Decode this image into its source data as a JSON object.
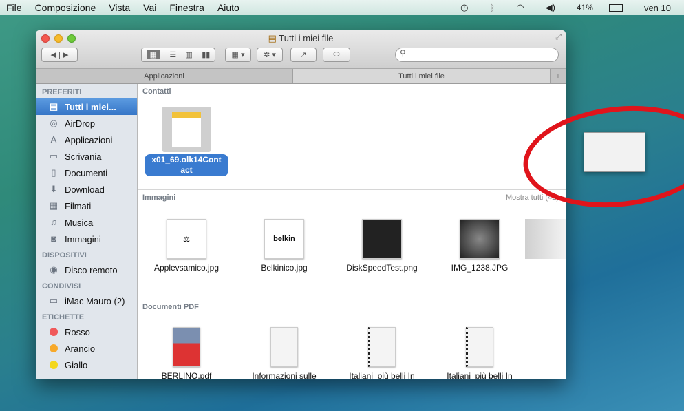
{
  "menubar": {
    "apple": "",
    "items": [
      "File",
      "Composizione",
      "Vista",
      "Vai",
      "Finestra",
      "Aiuto"
    ],
    "battery": "41%",
    "clock": "ven 10"
  },
  "window": {
    "title": "Tutti i miei file",
    "search_placeholder": "",
    "tabs": [
      "Applicazioni",
      "Tutti i miei file"
    ],
    "plus": "+"
  },
  "sidebar": {
    "sections": [
      {
        "title": "PREFERITI",
        "items": [
          {
            "label": "Tutti i miei...",
            "icon": "all-files-icon",
            "sel": true
          },
          {
            "label": "AirDrop",
            "icon": "airdrop-icon"
          },
          {
            "label": "Applicazioni",
            "icon": "applications-icon"
          },
          {
            "label": "Scrivania",
            "icon": "desktop-icon"
          },
          {
            "label": "Documenti",
            "icon": "documents-icon"
          },
          {
            "label": "Download",
            "icon": "download-icon"
          },
          {
            "label": "Filmati",
            "icon": "movies-icon"
          },
          {
            "label": "Musica",
            "icon": "music-icon"
          },
          {
            "label": "Immagini",
            "icon": "pictures-icon"
          }
        ]
      },
      {
        "title": "DISPOSITIVI",
        "items": [
          {
            "label": "Disco remoto",
            "icon": "remote-disc-icon"
          }
        ]
      },
      {
        "title": "CONDIVISI",
        "items": [
          {
            "label": "iMac Mauro (2)",
            "icon": "imac-icon"
          }
        ]
      },
      {
        "title": "ETICHETTE",
        "items": [
          {
            "label": "Rosso",
            "color": "#f0595a"
          },
          {
            "label": "Arancio",
            "color": "#f7a92a"
          },
          {
            "label": "Giallo",
            "color": "#f3d71c"
          }
        ]
      }
    ]
  },
  "content": {
    "contatti": {
      "title": "Contatti",
      "file": "x01_69.olk14Cont act"
    },
    "immagini": {
      "title": "Immagini",
      "more": "Mostra tutti (42)",
      "files": [
        "Applevsamico.jpg",
        "Belkinico.jpg",
        "DiskSpeedTest.png",
        "IMG_1238.JPG"
      ],
      "belkin": "belkin"
    },
    "pdf": {
      "title": "Documenti PDF",
      "files": [
        "BERLINO.pdf",
        "Informazioni sulle",
        "Italiani_più belli In",
        "Italiani_più belli In"
      ]
    }
  },
  "colors": {
    "selection": "#3a7bd0",
    "annotation": "#e0141b"
  }
}
